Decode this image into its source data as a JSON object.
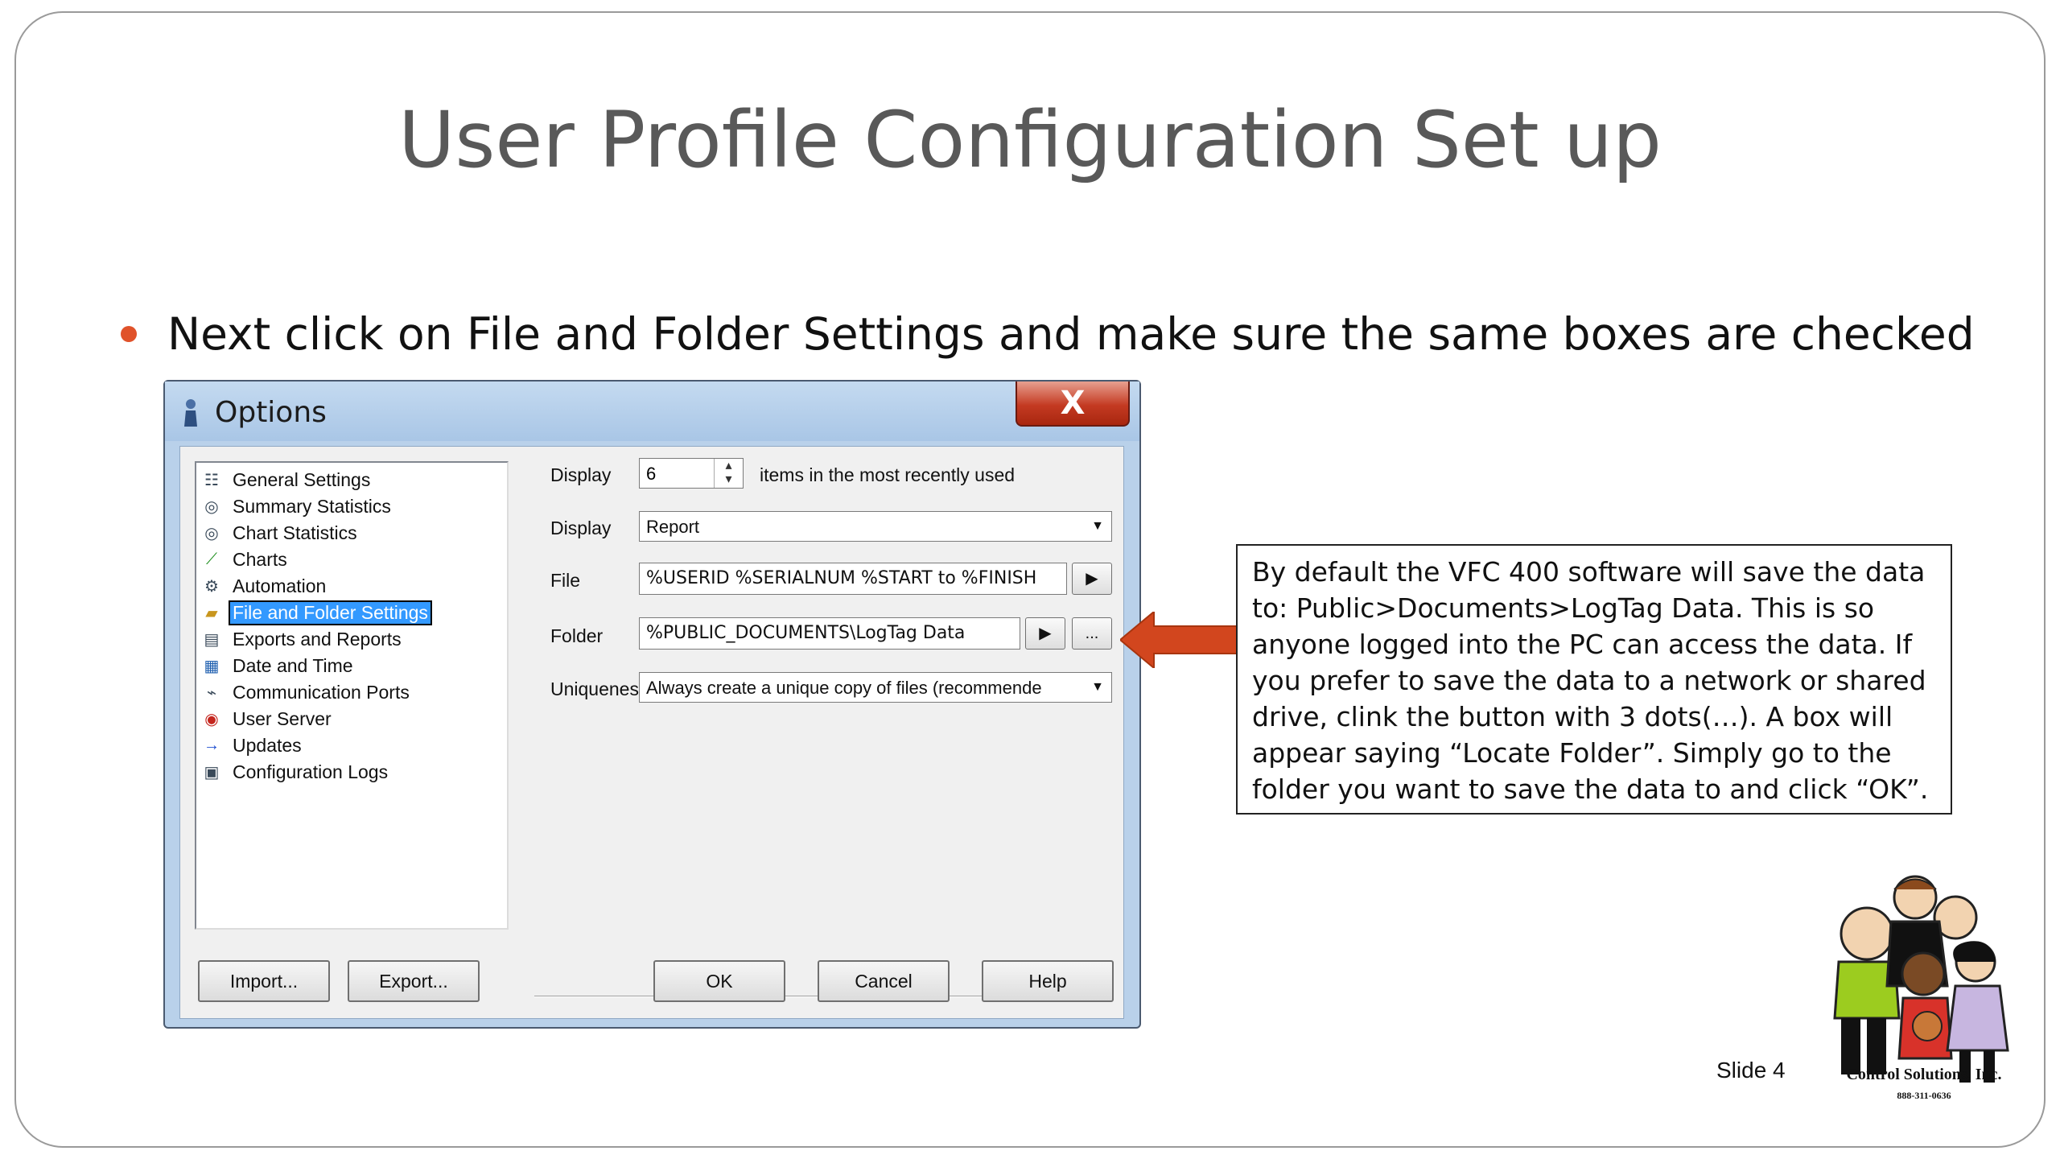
{
  "slide": {
    "title": "User Profile Configuration Set up",
    "bullet": "Next click on File and Folder Settings and make sure the same boxes are checked",
    "callout": "By default the VFC 400 software will save the data to: Public>Documents>LogTag Data. This is so anyone logged into the PC can access the data. If you prefer to save the data to a network or shared drive, clink the button with 3 dots(…). A box will appear saying “Locate Folder”. Simply go to the folder you want to save the data to and click “OK”.",
    "slide_number": "Slide 4",
    "logo_name": "Control Solutions, Inc.",
    "logo_phone": "888-311-0636",
    "accent_color": "#e0522a"
  },
  "dialog": {
    "title": "Options",
    "close_label": "X",
    "tree": [
      {
        "label": "General Settings",
        "icon": "general-settings-icon"
      },
      {
        "label": "Summary Statistics",
        "icon": "summary-statistics-icon"
      },
      {
        "label": "Chart Statistics",
        "icon": "chart-statistics-icon"
      },
      {
        "label": "Charts",
        "icon": "charts-icon"
      },
      {
        "label": "Automation",
        "icon": "automation-icon"
      },
      {
        "label": "File and Folder Settings",
        "icon": "folder-icon",
        "selected": true
      },
      {
        "label": "Exports and Reports",
        "icon": "exports-icon"
      },
      {
        "label": "Date and Time",
        "icon": "calendar-icon"
      },
      {
        "label": "Communication Ports",
        "icon": "ports-icon"
      },
      {
        "label": "User Server",
        "icon": "user-server-icon"
      },
      {
        "label": "Updates",
        "icon": "arrow-right-icon"
      },
      {
        "label": "Configuration Logs",
        "icon": "config-logs-icon"
      }
    ],
    "display1_label": "Display",
    "display1_value": "6",
    "display1_suffix": "items in the most recently used",
    "display2_label": "Display",
    "display2_value": "Report",
    "file_label": "File",
    "file_value": "%USERID %SERIALNUM %START to %FINISH",
    "folder_label": "Folder",
    "folder_value": "%PUBLIC_DOCUMENTS\\LogTag Data",
    "browse_label": "...",
    "uniqueness_label": "Uniqueness",
    "uniqueness_value": "Always create a unique copy of files (recommende",
    "buttons": {
      "import": "Import...",
      "export": "Export...",
      "ok": "OK",
      "cancel": "Cancel",
      "help": "Help"
    }
  }
}
